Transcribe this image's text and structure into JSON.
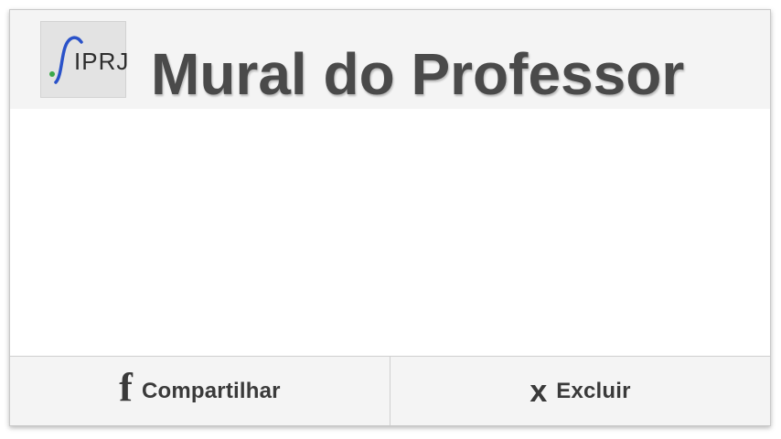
{
  "header": {
    "logo": {
      "text": "IPRJ",
      "icon": "iprj-logo-icon"
    },
    "title": "Mural do Professor"
  },
  "footer": {
    "share": {
      "icon_glyph": "f",
      "icon": "facebook-icon",
      "label": "Compartilhar"
    },
    "delete": {
      "icon_glyph": "x",
      "icon": "close-icon",
      "label": "Excluir"
    }
  },
  "colors": {
    "header_bg": "#f4f4f4",
    "title_text": "#4a4a4a",
    "logo_curve": "#2a52c9",
    "logo_dot": "#3aa84a"
  }
}
